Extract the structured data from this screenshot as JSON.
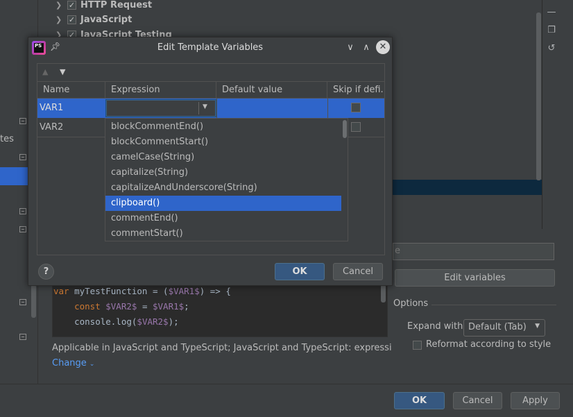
{
  "background": {
    "tree_items": [
      {
        "label": "HTTP Request",
        "checked": true
      },
      {
        "label": "JavaScript",
        "checked": true
      },
      {
        "label": "JavaScript Testing",
        "checked": true
      }
    ],
    "left_partial_text": "tes",
    "description_partial": "e",
    "edit_variables_label": "Edit variables",
    "code_lines": {
      "line1_kw": "var",
      "line1_plain": " myTestFunction = (",
      "line1_var": "$VAR1$",
      "line1_end": ") => {",
      "line2_kw": "    const",
      "line2_var1": " $VAR2$",
      "line2_mid": " = ",
      "line2_var2": "$VAR1$",
      "line2_end": ";",
      "line3_plain": "    console.log(",
      "line3_var": "$VAR2$",
      "line3_end": ");"
    },
    "options_label": "Options",
    "expand_with_label": "Expand with",
    "expand_with_value": "Default (Tab)",
    "reformat_label": "Reformat according to style",
    "applicable_text": "Applicable in JavaScript and TypeScript; JavaScript and TypeScript: expression, JS...",
    "change_label": "Change",
    "ok_label": "OK",
    "cancel_label": "Cancel",
    "apply_label": "Apply"
  },
  "dialog": {
    "title": "Edit Template Variables",
    "logo_text": "PS",
    "columns": [
      "Name",
      "Expression",
      "Default value",
      "Skip if defi..."
    ],
    "rows": [
      {
        "name": "VAR1",
        "expression": "",
        "default_value": "",
        "skip": false
      },
      {
        "name": "VAR2",
        "expression": "",
        "default_value": "",
        "skip": false
      }
    ],
    "completion_items": [
      "blockCommentEnd()",
      "blockCommentStart()",
      "camelCase(String)",
      "capitalize(String)",
      "capitalizeAndUnderscore(String)",
      "clipboard()",
      "commentEnd()",
      "commentStart()"
    ],
    "selected_completion": "clipboard()",
    "help_label": "?",
    "ok_label": "OK",
    "cancel_label": "Cancel"
  },
  "colors": {
    "accent": "#2f65ca",
    "default_button": "#365880",
    "link": "#589df6"
  }
}
